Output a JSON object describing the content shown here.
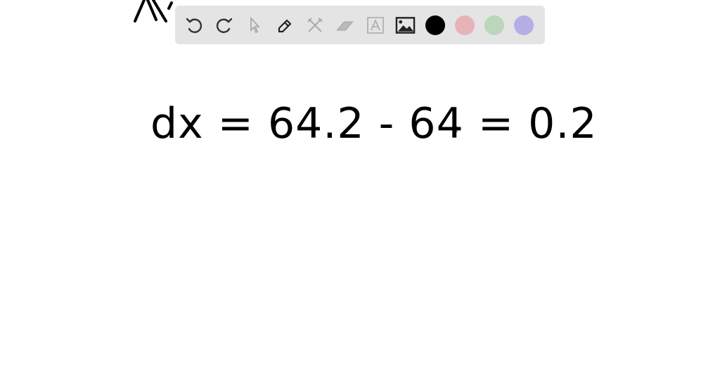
{
  "toolbar": {
    "tools": [
      "undo-icon",
      "redo-icon",
      "select-icon",
      "pen-icon",
      "tools-icon",
      "eraser-icon",
      "text-icon",
      "image-icon"
    ],
    "colors": [
      "#000000",
      "#e6b3b8",
      "#bcd6bc",
      "#b3aee6"
    ]
  },
  "canvas": {
    "handwriting": "dx = 64.2 - 64 = 0.2"
  }
}
